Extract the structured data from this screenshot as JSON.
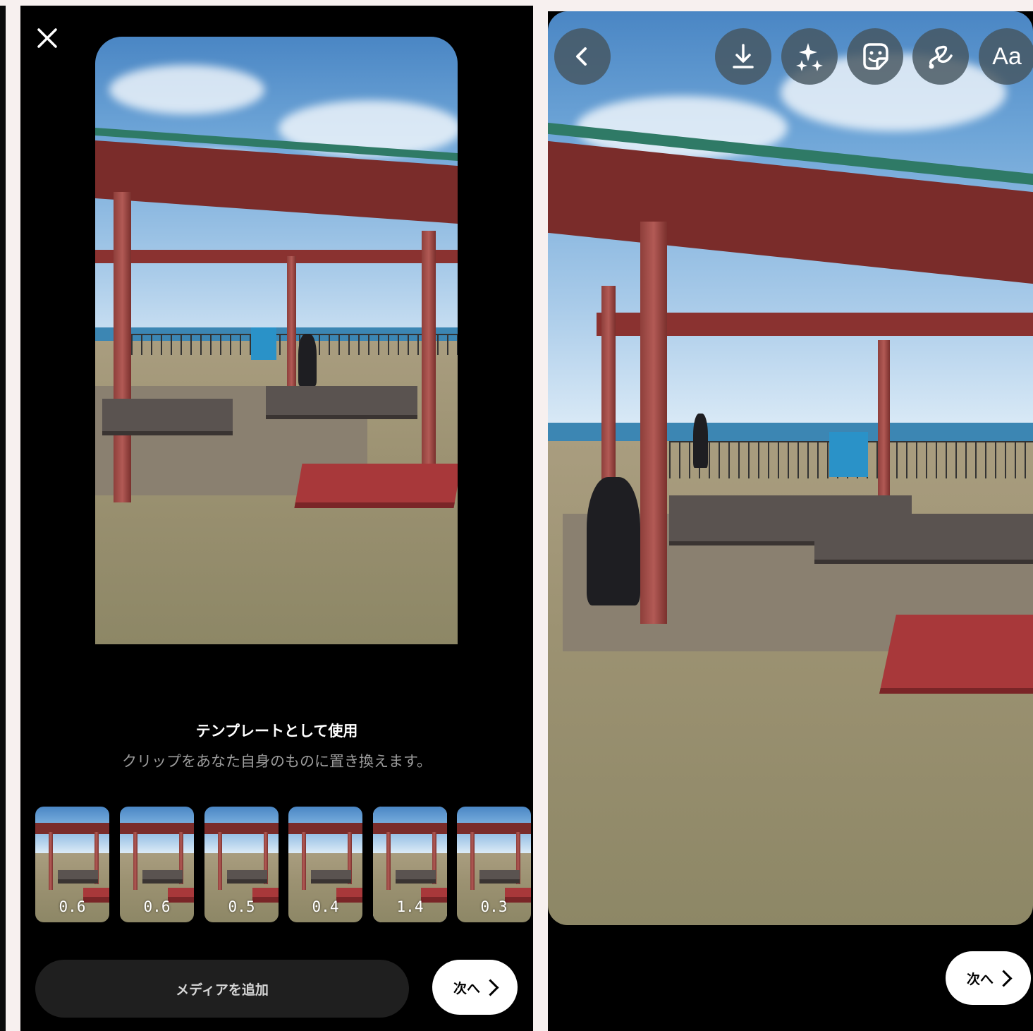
{
  "left": {
    "close_label": "×",
    "template_title": "テンプレートとして使用",
    "template_subtitle": "クリップをあなた自身のものに置き換えます。",
    "clips": [
      {
        "duration": "0.6",
        "selected": false
      },
      {
        "duration": "0.6",
        "selected": false
      },
      {
        "duration": "0.5",
        "selected": false
      },
      {
        "duration": "0.4",
        "selected": false
      },
      {
        "duration": "1.4",
        "selected": true
      },
      {
        "duration": "0.3",
        "selected": false
      }
    ],
    "add_media_label": "メディアを追加",
    "next_label": "次へ"
  },
  "right": {
    "toolbar": {
      "back_icon": "chevron-left-icon",
      "download_icon": "download-icon",
      "effects_icon": "sparkles-icon",
      "sticker_icon": "sticker-icon",
      "draw_icon": "squiggle-draw-icon",
      "text_label": "Aa"
    },
    "next_label": "次へ"
  },
  "colors": {
    "panel_bg": "#000000",
    "page_bg": "#f7f0ef",
    "button_dark": "#1f1f1f",
    "toolbar_button": "#46555f",
    "next_button": "#ffffff"
  }
}
